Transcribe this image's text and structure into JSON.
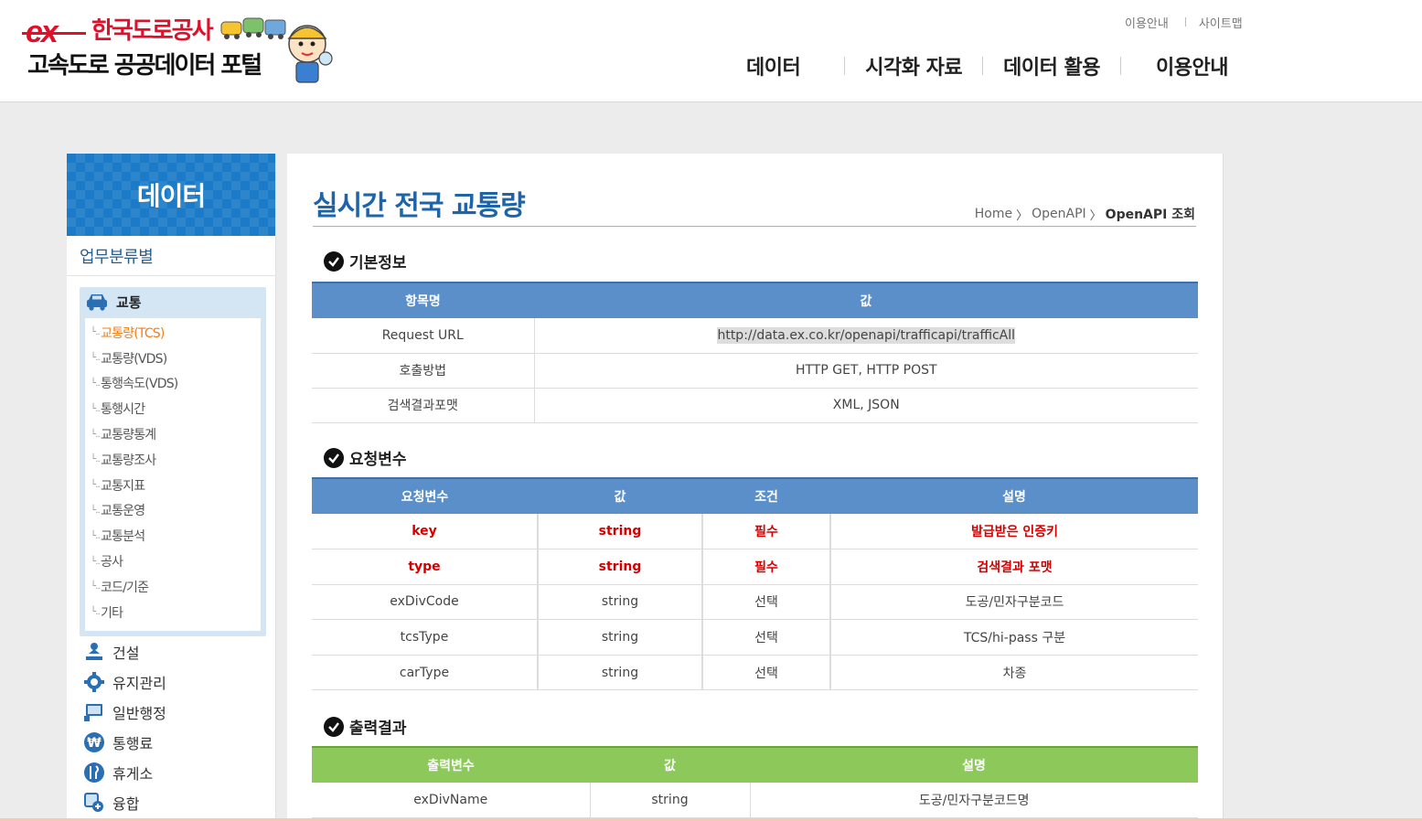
{
  "logo": {
    "ex": "ex",
    "corp": "한국도로공사",
    "portal": "고속도로 공공데이터 포털"
  },
  "util_nav": {
    "guide": "이용안내",
    "sitemap": "사이트맵"
  },
  "gnb": [
    "데이터",
    "시각화 자료",
    "데이터 활용",
    "이용안내"
  ],
  "sidebar": {
    "title": "데이터",
    "subtitle": "업무분류별",
    "active_category": {
      "label": "교통",
      "icon": "car-icon"
    },
    "sub_items": [
      {
        "label": "교통량(TCS)",
        "active": true
      },
      {
        "label": "교통량(VDS)"
      },
      {
        "label": "통행속도(VDS)"
      },
      {
        "label": "통행시간"
      },
      {
        "label": "교통량통계"
      },
      {
        "label": "교통량조사"
      },
      {
        "label": "교통지표"
      },
      {
        "label": "교통운영"
      },
      {
        "label": "교통분석"
      },
      {
        "label": "공사"
      },
      {
        "label": "코드/기준"
      },
      {
        "label": "기타"
      }
    ],
    "categories": [
      {
        "label": "건설",
        "icon": "construction-icon"
      },
      {
        "label": "유지관리",
        "icon": "maintenance-icon"
      },
      {
        "label": "일반행정",
        "icon": "admin-icon"
      },
      {
        "label": "통행료",
        "icon": "toll-icon"
      },
      {
        "label": "휴게소",
        "icon": "rest-area-icon"
      },
      {
        "label": "융합",
        "icon": "fusion-icon"
      }
    ]
  },
  "content": {
    "title": "실시간 전국 교통량",
    "breadcrumb": [
      "Home",
      "OpenAPI",
      "OpenAPI 조회"
    ],
    "basic": {
      "heading": "기본정보",
      "headers": [
        "항목명",
        "값"
      ],
      "rows": [
        [
          "Request URL",
          "http://data.ex.co.kr/openapi/trafficapi/trafficAll"
        ],
        [
          "호출방법",
          "HTTP GET, HTTP POST"
        ],
        [
          "검색결과포맷",
          "XML, JSON"
        ]
      ]
    },
    "request": {
      "heading": "요청변수",
      "headers": [
        "요청변수",
        "값",
        "조건",
        "설명"
      ],
      "rows": [
        [
          "key",
          "string",
          "필수",
          "발급받은 인증키"
        ],
        [
          "type",
          "string",
          "필수",
          "검색결과 포맷"
        ],
        [
          "exDivCode",
          "string",
          "선택",
          "도공/민자구분코드"
        ],
        [
          "tcsType",
          "string",
          "선택",
          "TCS/hi-pass 구분"
        ],
        [
          "carType",
          "string",
          "선택",
          "차종"
        ]
      ]
    },
    "output": {
      "heading": "출력결과",
      "headers": [
        "출력변수",
        "값",
        "설명"
      ],
      "rows": [
        [
          "exDivName",
          "string",
          "도공/민자구분코드명"
        ]
      ]
    }
  },
  "colors": {
    "brand_red": "#e0102a",
    "header_blue": "#5b8fc9",
    "header_green": "#8dc95a",
    "title_blue": "#1e64a8",
    "active_orange": "#f07f1a",
    "required_red": "#d40000"
  }
}
